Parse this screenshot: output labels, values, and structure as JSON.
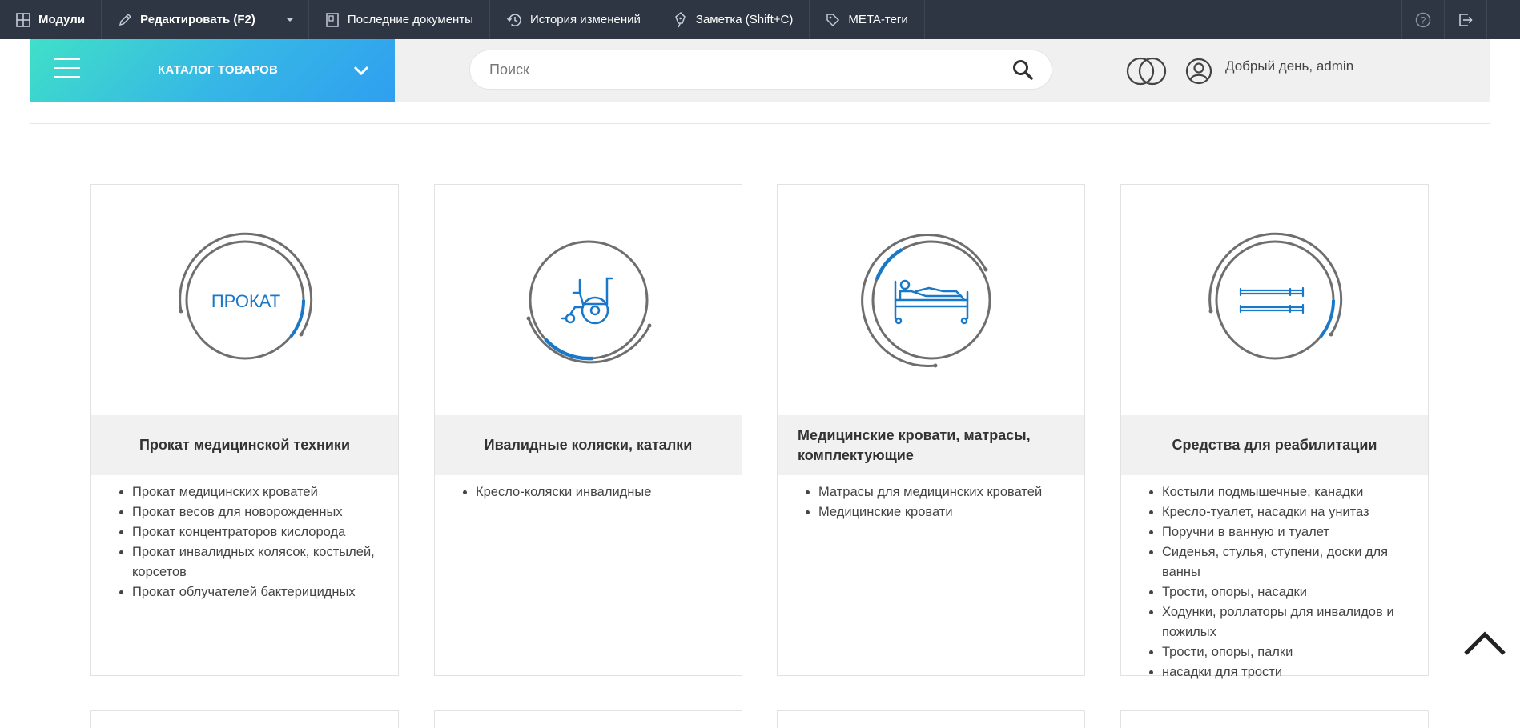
{
  "admin_bar": {
    "modules": "Модули",
    "edit": "Редактировать (F2)",
    "recent_docs": "Последние документы",
    "history": "История изменений",
    "note": "Заметка (Shift+C)",
    "meta_tags": "META-теги"
  },
  "header": {
    "catalog_label": "КАТАЛОГ ТОВАРОВ",
    "search_placeholder": "Поиск",
    "greeting": "Добрый день, admin"
  },
  "cards": [
    {
      "title": "Прокат медицинской техники",
      "icon_text": "ПРОКАТ",
      "items": [
        "Прокат медицинских кроватей",
        "Прокат весов для новорожденных",
        "Прокат концентраторов кислорода",
        "Прокат инвалидных колясок, костылей, корсетов",
        "Прокат облучателей бактерицидных"
      ]
    },
    {
      "title": "Ивалидные коляски, каталки",
      "items": [
        "Кресло-коляски инвалидные"
      ]
    },
    {
      "title": "Медицинские кровати, матрасы, комплектующие",
      "items": [
        "Матрасы для медицинских кроватей",
        "Медицинские кровати"
      ]
    },
    {
      "title": "Средства для реабилитации",
      "items": [
        "Костыли подмышечные, канадки",
        "Кресло-туалет, насадки на унитаз",
        "Поручни в ванную и туалет",
        "Сиденья, стулья, ступени, доски для ванны",
        "Трости, опоры, насадки",
        "Ходунки, роллаторы для инвалидов и пожилых",
        "Трости, опоры, палки",
        "насадки для трости"
      ]
    }
  ],
  "colors": {
    "admin_bar_bg": "#2d3642",
    "accent_blue": "#1a78c8",
    "icon_gray": "#6e6e6e",
    "catalog_gradient_start": "#3fe0c8",
    "catalog_gradient_end": "#2f9ff0"
  },
  "icons": {
    "modules": "grid-icon",
    "edit": "pencil-icon",
    "recent_docs": "document-icon",
    "history": "history-icon",
    "note": "pen-nib-icon",
    "meta_tags": "tag-icon",
    "help": "help-icon",
    "logout": "logout-icon",
    "search": "search-icon",
    "compare": "compare-icon",
    "user": "user-icon",
    "scroll_top": "chevron-up-icon"
  }
}
